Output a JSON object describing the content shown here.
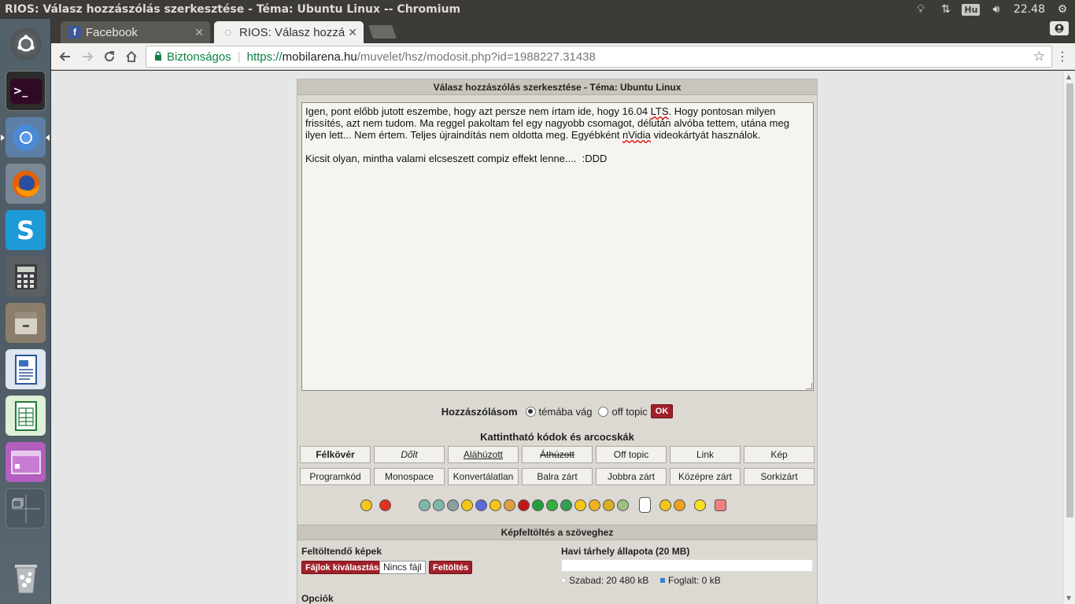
{
  "system": {
    "window_title": "RIOS: Válasz hozzászólás szerkesztése - Téma: Ubuntu Linux -- Chromium",
    "keyboard_layout": "Hu",
    "clock": "22.48"
  },
  "launcher": {
    "items": [
      "ubuntu-dash",
      "terminal",
      "chromium",
      "firefox",
      "skype",
      "calculator",
      "files",
      "writer",
      "calc",
      "impress",
      "workspace-switcher",
      "trash"
    ]
  },
  "browser": {
    "tabs": [
      {
        "label": "Facebook",
        "active": false
      },
      {
        "label": "RIOS: Válasz hozzá",
        "active": true
      }
    ],
    "security_label": "Biztonságos",
    "url_scheme": "https://",
    "url_host": "mobilarena.hu",
    "url_path": "/muvelet/hsz/modosit.php?id=1988227.31438"
  },
  "page": {
    "header": "Válasz hozzászólás szerkesztése - Téma: Ubuntu Linux",
    "editor_lines": [
      "Igen, pont előbb jutott eszembe, hogy azt persze nem írtam ide, hogy 16.04 LTS. Hogy pontosan milyen",
      "frissítés, azt nem tudom. Ma reggel pakoltam fel egy nagyobb csomagot, délután alvóba tettem, utána meg",
      "ilyen lett... Nem értem. Teljes újraindítás nem oldotta meg. Egyébként nVidia videokártyát használok.",
      "",
      "Kicsit olyan, mintha valami elcseszett compiz effekt lenne....  :DDD "
    ],
    "post_type_label": "Hozzászólásom",
    "option_on_topic": "témába vág",
    "option_off_topic": "off topic",
    "ok_label": "OK",
    "codes_title": "Kattintható kódok és arcocskák",
    "code_buttons_row1": [
      "Félkövér",
      "Dőlt",
      "Aláhúzott",
      "Áthúzott",
      "Off topic",
      "Link",
      "Kép"
    ],
    "code_buttons_row2": [
      "Programkód",
      "Monospace",
      "Konvertálatlan",
      "Balra zárt",
      "Jobbra zárt",
      "Középre zárt",
      "Sorkizárt"
    ],
    "upload_title": "Képfeltöltés a szöveghez",
    "upload_images_label": "Feltöltendő képek",
    "choose_files_label": "Fájlok kiválasztása",
    "no_file_label": "Nincs fájl",
    "upload_button_label": "Feltöltés",
    "quota_title": "Havi tárhely állapota (20 MB)",
    "free_label": "Szabad: 20 480 kB",
    "used_label": "Foglalt: 0 kB",
    "used_fraction": 0,
    "options_label": "Opciók"
  },
  "colors": {
    "accent_red": "#a0202a",
    "secure_green": "#0b8043",
    "panel_bg": "#dcd9d2"
  }
}
